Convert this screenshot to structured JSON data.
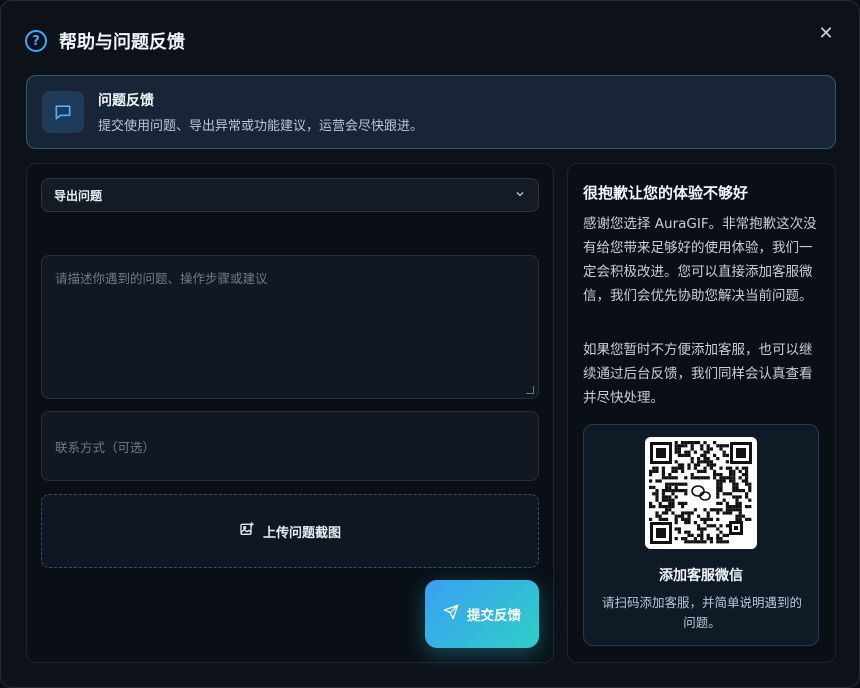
{
  "dialog": {
    "title": "帮助与问题反馈",
    "close_label": "✕"
  },
  "banner": {
    "title": "问题反馈",
    "description": "提交使用问题、导出异常或功能建议，运营会尽快跟进。"
  },
  "form": {
    "category_selected": "导出问题",
    "description_placeholder": "请描述你遇到的问题、操作步骤或建议",
    "contact_placeholder": "联系方式（可选）",
    "upload_label": "上传问题截图",
    "submit_label": "提交反馈"
  },
  "info": {
    "title": "很抱歉让您的体验不够好",
    "paragraph1": "感谢您选择 AuraGIF。非常抱歉这次没有给您带来足够好的使用体验，我们一定会积极改进。您可以直接添加客服微信，我们会优先协助您解决当前问题。",
    "paragraph2": "如果您暂时不方便添加客服，也可以继续通过后台反馈，我们同样会认真查看并尽快处理。",
    "qr_title": "添加客服微信",
    "qr_description": "请扫码添加客服，并简单说明遇到的问题。"
  },
  "colors": {
    "accent": "#3ea8ff",
    "submit_gradient_start": "#39a0f5",
    "submit_gradient_end": "#2ecfc6"
  },
  "icons": {
    "header": "help-circle-icon",
    "banner": "message-square-icon",
    "close": "close-icon",
    "select": "chevron-down-icon",
    "upload": "image-plus-icon",
    "submit": "send-icon",
    "qr_center": "wechat-icon"
  }
}
